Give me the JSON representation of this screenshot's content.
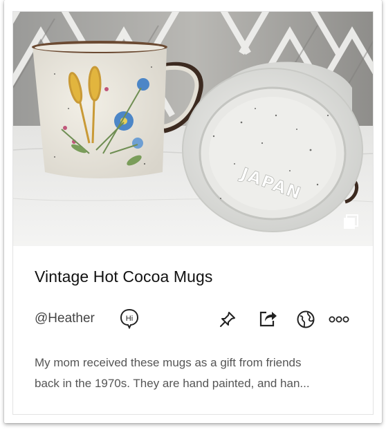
{
  "card": {
    "title": "Vintage Hot Cocoa Mugs",
    "author": "@Heather",
    "hi_badge": "Hi",
    "description_line1": "My mom received these mugs as a gift from friends",
    "description_line2": "back in the 1970s. They are hand painted, and han...",
    "mug_stamp": "JAPAN"
  },
  "icons": {
    "pin": "pin-icon",
    "share": "share-icon",
    "globe": "globe-icon",
    "more": "more-icon",
    "gallery": "gallery-icon",
    "hi": "hi-chat-icon"
  }
}
